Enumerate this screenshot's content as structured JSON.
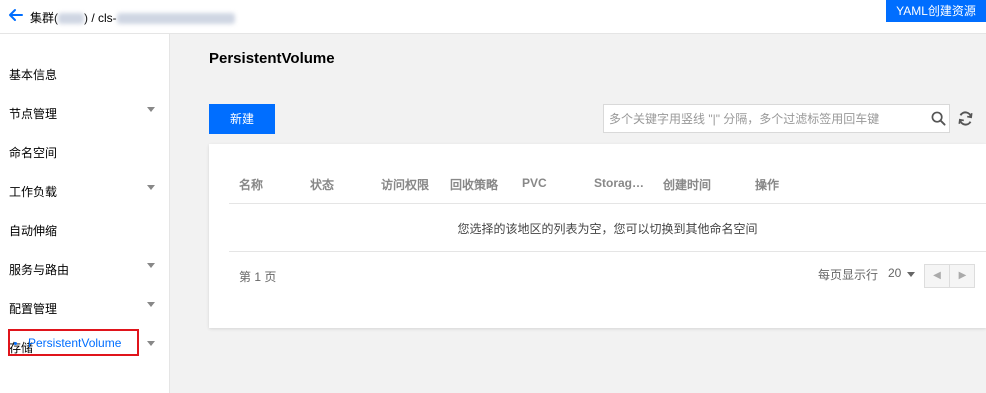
{
  "header": {
    "breadcrumb_cluster": "集群(",
    "breadcrumb_cluster_close": ") /",
    "breadcrumb_cluster_id_prefix": "cls-",
    "yaml_button": "YAML创建资源"
  },
  "sidebar": {
    "items": [
      {
        "label": "基本信息",
        "expandable": false
      },
      {
        "label": "节点管理",
        "expandable": true
      },
      {
        "label": "命名空间",
        "expandable": false
      },
      {
        "label": "工作负载",
        "expandable": true
      },
      {
        "label": "自动伸缩",
        "expandable": false
      },
      {
        "label": "服务与路由",
        "expandable": true
      },
      {
        "label": "配置管理",
        "expandable": true
      },
      {
        "label": "存储",
        "expandable": true
      }
    ],
    "active_sub_item": "PersistentVolume"
  },
  "main": {
    "title": "PersistentVolume",
    "new_button": "新建",
    "search_placeholder": "多个关键字用竖线 \"|\" 分隔，多个过滤标签用回车键",
    "table": {
      "columns": [
        "名称",
        "状态",
        "访问权限",
        "回收策略",
        "PVC",
        "Storag…",
        "创建时间",
        "操作"
      ],
      "empty_message": "您选择的该地区的列表为空，您可以切换到其他命名空间"
    },
    "pagination": {
      "page_info": "第 1 页",
      "per_page_label": "每页显示行",
      "page_size": "20"
    }
  },
  "colors": {
    "primary": "#006eff",
    "highlight_border": "#e0141b"
  }
}
